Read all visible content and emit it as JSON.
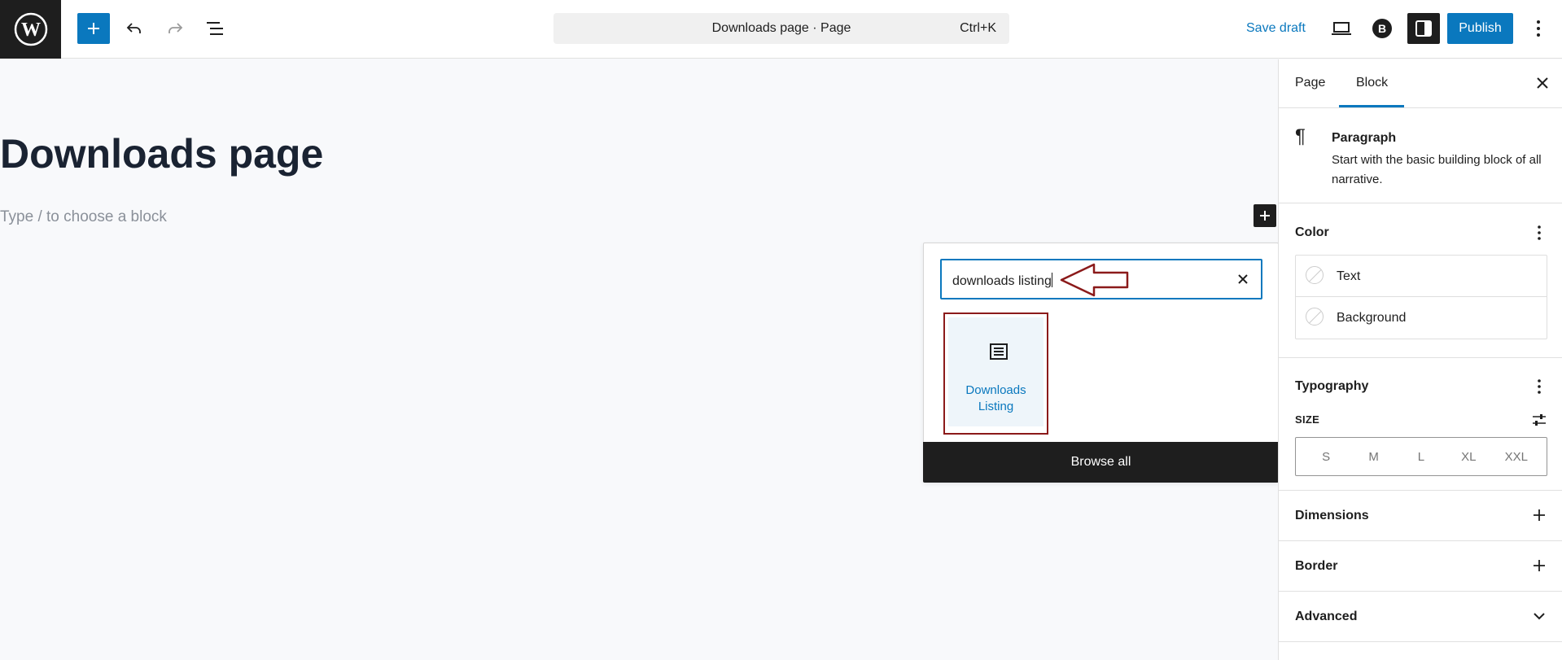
{
  "header": {
    "document_title": "Downloads page · Page",
    "shortcut": "Ctrl+K",
    "save_draft_label": "Save draft",
    "publish_label": "Publish"
  },
  "editor": {
    "post_title": "Downloads page",
    "block_placeholder": "Type / to choose a block"
  },
  "inserter": {
    "search_value": "downloads listing",
    "results": [
      {
        "label_line1": "Downloads",
        "label_line2": "Listing",
        "icon": "list-view-icon"
      }
    ],
    "browse_all_label": "Browse all"
  },
  "sidebar": {
    "tabs": [
      "Page",
      "Block"
    ],
    "active_tab": "Block",
    "block_card": {
      "title": "Paragraph",
      "description": "Start with the basic building block of all narrative."
    },
    "color": {
      "title": "Color",
      "items": [
        "Text",
        "Background"
      ]
    },
    "typography": {
      "title": "Typography",
      "size_label": "SIZE",
      "sizes": [
        "S",
        "M",
        "L",
        "XL",
        "XXL"
      ]
    },
    "dimensions_title": "Dimensions",
    "border_title": "Border",
    "advanced_title": "Advanced"
  },
  "colors": {
    "accent": "#0a78be",
    "annotation": "#8b1a1a",
    "dark": "#1e1e1e"
  }
}
